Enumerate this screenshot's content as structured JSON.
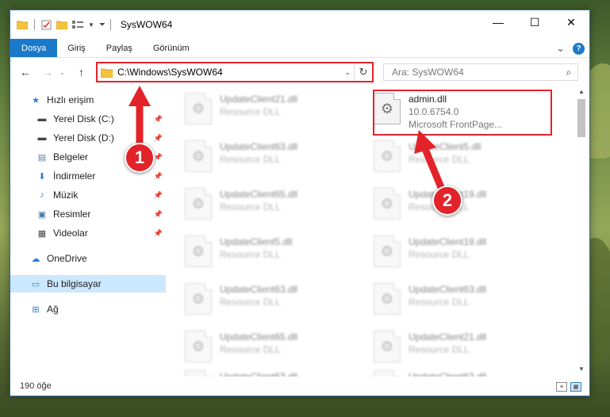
{
  "window": {
    "title": "SysWOW64",
    "controls": {
      "minimize": "—",
      "maximize": "☐",
      "close": "✕"
    }
  },
  "ribbon": {
    "tabs": [
      "Dosya",
      "Giriş",
      "Paylaş",
      "Görünüm"
    ],
    "expand": "⌄",
    "help": "?"
  },
  "address": {
    "path": "C:\\Windows\\SysWOW64",
    "search_placeholder": "Ara: SysWOW64"
  },
  "sidebar": {
    "items": [
      {
        "label": "Hızlı erişim",
        "icon": "star-icon",
        "glyph": "★",
        "color": "#2a7bd4"
      },
      {
        "label": "Yerel Disk (C:)",
        "icon": "drive-icon",
        "glyph": "▬",
        "color": "#444",
        "pinned": true
      },
      {
        "label": "Yerel Disk (D:)",
        "icon": "drive-icon",
        "glyph": "▬",
        "color": "#444",
        "pinned": true
      },
      {
        "label": "Belgeler",
        "icon": "documents-icon",
        "glyph": "▤",
        "color": "#5a7fa8",
        "pinned": true
      },
      {
        "label": "İndirmeler",
        "icon": "download-icon",
        "glyph": "⬇",
        "color": "#2a7bd4",
        "pinned": true
      },
      {
        "label": "Müzik",
        "icon": "music-icon",
        "glyph": "♪",
        "color": "#2a7bd4",
        "pinned": true
      },
      {
        "label": "Resimler",
        "icon": "pictures-icon",
        "glyph": "▣",
        "color": "#4b7aa6",
        "pinned": true
      },
      {
        "label": "Videolar",
        "icon": "videos-icon",
        "glyph": "▦",
        "color": "#444",
        "pinned": true
      },
      {
        "label": "OneDrive",
        "icon": "cloud-icon",
        "glyph": "☁",
        "color": "#2a7bd4"
      },
      {
        "label": "Bu bilgisayar",
        "icon": "computer-icon",
        "glyph": "▭",
        "color": "#2a7bd4"
      },
      {
        "label": "Ağ",
        "icon": "network-icon",
        "glyph": "⊞",
        "color": "#2a7bd4"
      }
    ]
  },
  "files": {
    "left": [
      {
        "name": "UpdateClient21.dll",
        "type": "Resource DLL"
      },
      {
        "name": "UpdateClient63.dll",
        "type": "Resource DLL"
      },
      {
        "name": "UpdateClient65.dll",
        "type": "Resource DLL"
      },
      {
        "name": "UpdateClient5.dll",
        "type": "Resource DLL"
      },
      {
        "name": "UpdateClient63.dll",
        "type": "Resource DLL"
      },
      {
        "name": "UpdateClient65.dll",
        "type": "Resource DLL"
      },
      {
        "name": "UpdateClient63.dll",
        "type": "Resource DLL"
      }
    ],
    "right": [
      {
        "name": "UpdateClient5.dll",
        "type": "Resource DLL"
      },
      {
        "name": "UpdateClient19.dll",
        "type": "Resource DLL"
      },
      {
        "name": "UpdateClient19.dll",
        "type": "Resource DLL"
      },
      {
        "name": "UpdateClient63.dll",
        "type": "Resource DLL"
      },
      {
        "name": "UpdateClient21.dll",
        "type": "Resource DLL"
      },
      {
        "name": "UpdateClient63.dll",
        "type": "Resource DLL"
      }
    ],
    "highlighted": {
      "name": "admin.dll",
      "version": "10.0.6754.0",
      "description": "Microsoft FrontPage..."
    }
  },
  "status": {
    "item_count": "190 öğe"
  },
  "annotations": {
    "badge1": "1",
    "badge2": "2",
    "accent": "#e2232a"
  }
}
